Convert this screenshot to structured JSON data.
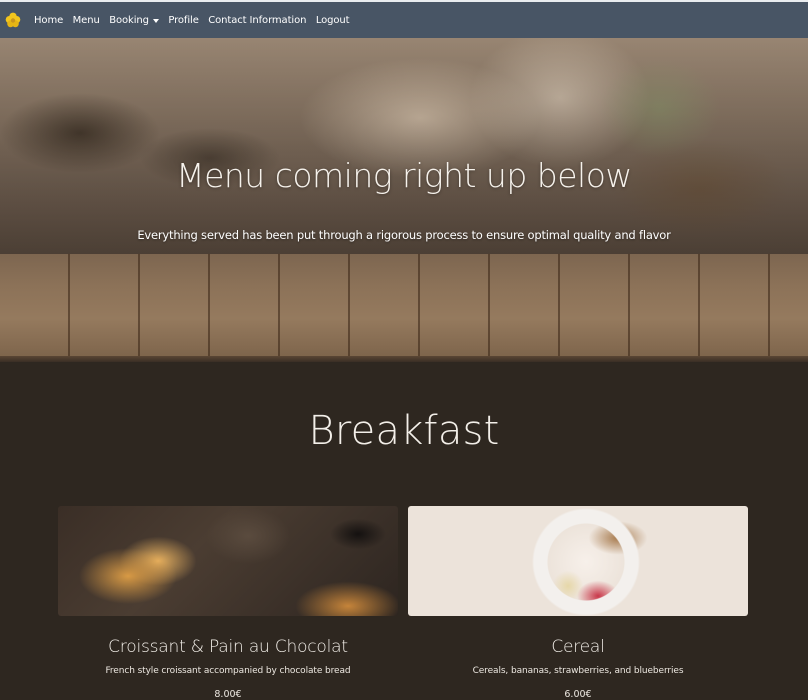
{
  "navbar": {
    "brand_icon": "yellow-flower-logo",
    "items": [
      {
        "label": "Home"
      },
      {
        "label": "Menu"
      },
      {
        "label": "Booking",
        "has_dropdown": true
      },
      {
        "label": "Profile"
      },
      {
        "label": "Contact Information"
      },
      {
        "label": "Logout"
      }
    ],
    "background": "#485565"
  },
  "hero": {
    "title": "Menu coming right up below",
    "subtitle": "Everything served has been put through a rigorous process to ensure optimal quality and flavor"
  },
  "section": {
    "title": "Breakfast",
    "items": [
      {
        "name": "Croissant & Pain au Chocolat",
        "description": "French style croissant accompanied by chocolate bread",
        "price": "8.00€",
        "image": "croissants-photo"
      },
      {
        "name": "Cereal",
        "description": "Cereals, bananas, strawberries, and blueberries",
        "price": "6.00€",
        "image": "cereal-bowl-photo"
      }
    ]
  },
  "colors": {
    "page_background": "#2e2720",
    "text": "#f4f0ea"
  }
}
